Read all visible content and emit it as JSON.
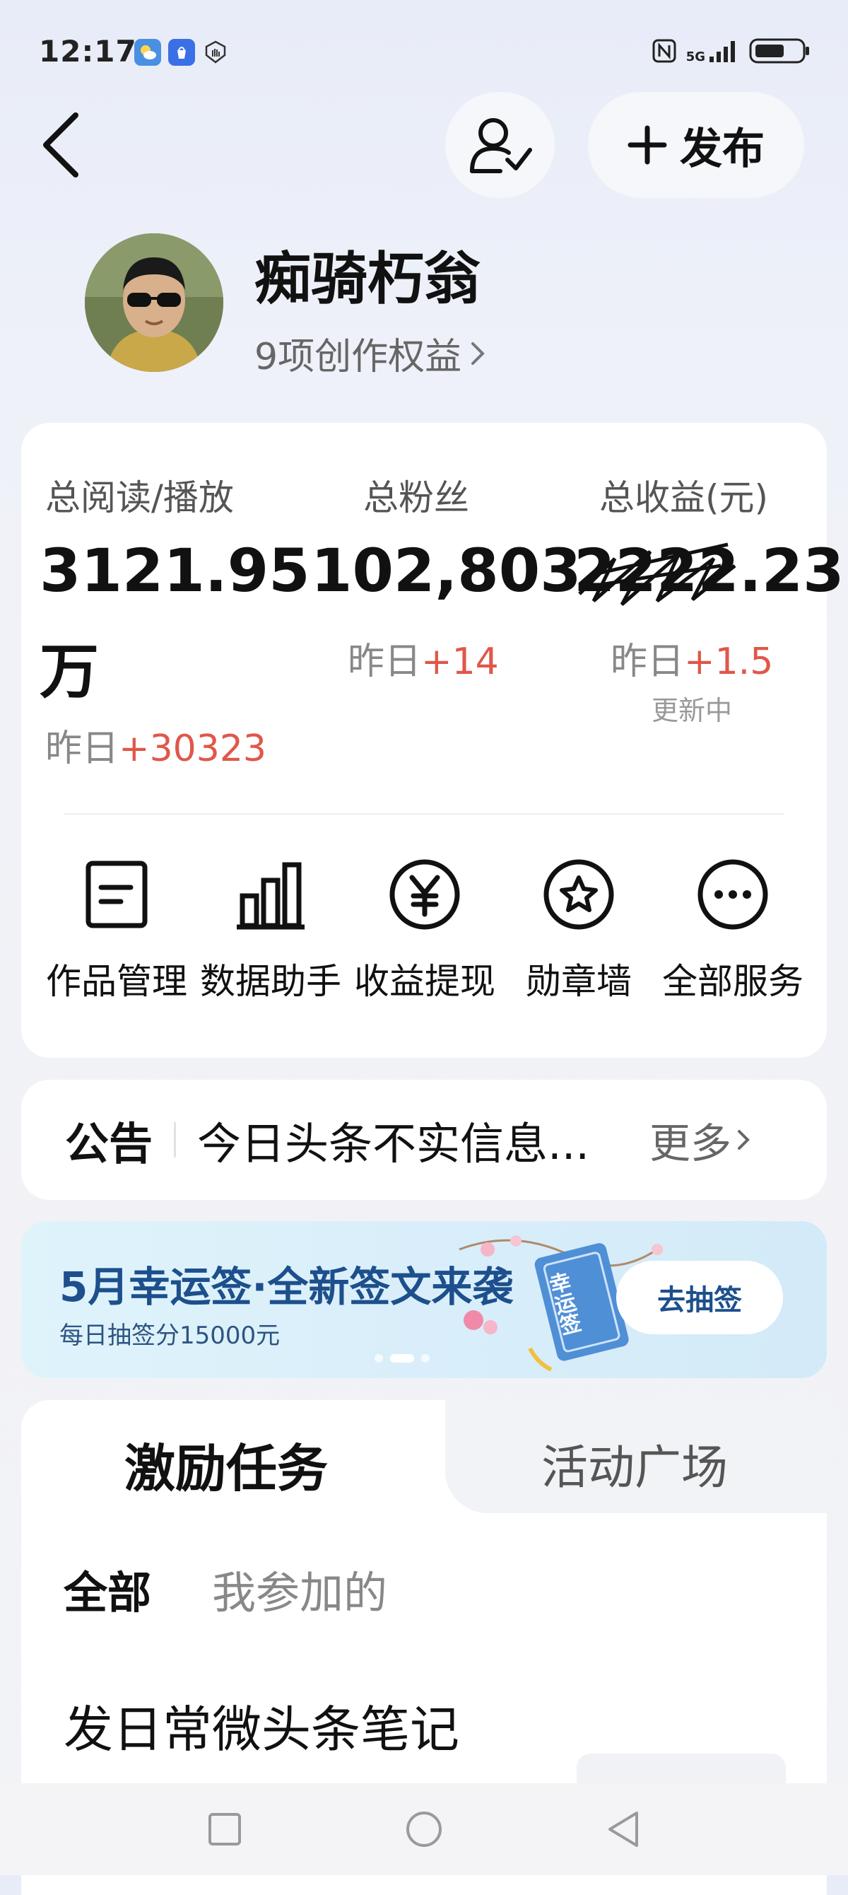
{
  "status_bar": {
    "time": "12:17",
    "network": "5G",
    "colors": {
      "weather": "#4a90e2",
      "app_market": "#3b6fe6"
    }
  },
  "header": {
    "publish_label": "发布"
  },
  "profile": {
    "name": "痴骑朽翁",
    "rights_label": "9项创作权益"
  },
  "stats": [
    {
      "label": "总阅读/播放",
      "value_line1": "3121.95",
      "value_line2": "万",
      "delta_prefix": "昨日",
      "delta": "+30323"
    },
    {
      "label": "总粉丝",
      "value_line1": "102,803",
      "delta_prefix": "昨日",
      "delta": "+14"
    },
    {
      "label": "总收益(元)",
      "value_line1": "2222.23",
      "delta_prefix": "昨日",
      "delta": "+1.5",
      "note": "更新中"
    }
  ],
  "services": [
    {
      "label": "作品管理",
      "icon": "document-icon"
    },
    {
      "label": "数据助手",
      "icon": "bar-chart-icon"
    },
    {
      "label": "收益提现",
      "icon": "yen-icon"
    },
    {
      "label": "勋章墙",
      "icon": "medal-icon"
    },
    {
      "label": "全部服务",
      "icon": "more-icon"
    }
  ],
  "notice": {
    "tag": "公告",
    "text": "今日头条不实信息...",
    "more": "更多"
  },
  "banner": {
    "title": "5月幸运签·全新签文来袭",
    "subtitle": "每日抽签分15000元",
    "button": "去抽签",
    "sign_text": "幸运签"
  },
  "tasks": {
    "tab_active": "激励任务",
    "tab_inactive": "活动广场",
    "filter_all": "全部",
    "filter_joined": "我参加的",
    "first_task": "发日常微头条笔记"
  },
  "colors": {
    "accent_red": "#e0574a",
    "banner_title": "#1d4f8c"
  }
}
